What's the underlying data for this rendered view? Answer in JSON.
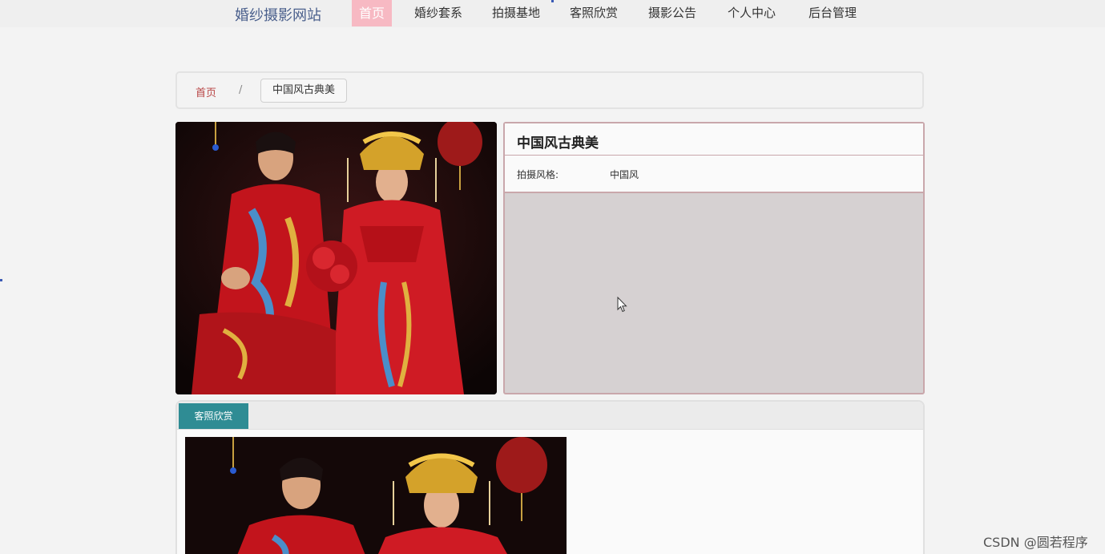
{
  "nav": {
    "brand": "婚纱摄影网站",
    "items": [
      {
        "label": "首页",
        "active": true
      },
      {
        "label": "婚纱套系",
        "active": false
      },
      {
        "label": "拍摄基地",
        "active": false
      },
      {
        "label": "客照欣赏",
        "active": false
      },
      {
        "label": "摄影公告",
        "active": false
      },
      {
        "label": "个人中心",
        "active": false
      },
      {
        "label": "后台管理",
        "active": false
      }
    ]
  },
  "breadcrumb": {
    "home": "首页",
    "separator": "/",
    "current": "中国风古典美"
  },
  "detail": {
    "title": "中国风古典美",
    "style_label": "拍摄风格:",
    "style_value": "中国风"
  },
  "gallery": {
    "tab_label": "客照欣赏"
  },
  "watermark": "CSDN @圆若程序",
  "colors": {
    "accent_pink": "#f7b9c3",
    "teal_tab": "#2f8c94",
    "breadcrumb_home": "#b84545",
    "panel_border": "#c9a7ab"
  }
}
